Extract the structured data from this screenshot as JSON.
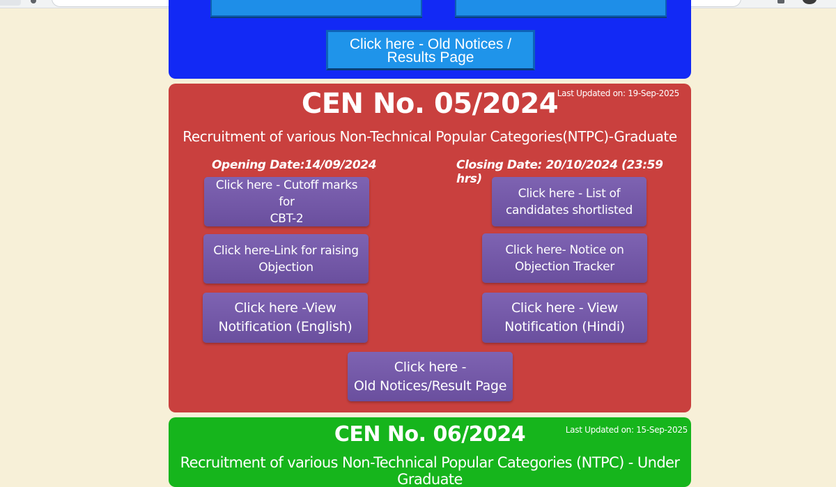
{
  "colors": {
    "page_background": "#f7f0d8",
    "blue_panel": "#1229f5",
    "blue_button": "#1f94ea",
    "red_panel": "#c9403e",
    "purple_button": "#7260a8",
    "green_panel": "#16b51c"
  },
  "browser": {
    "icons": [
      "back-icon",
      "extension-icon",
      "profile-avatar"
    ]
  },
  "top_section": {
    "old_notices_button": "Click here - Old Notices /\nResults Page"
  },
  "cen_05_2024": {
    "title": "CEN No. 05/2024",
    "last_updated": "Last Updated on: 19-Sep-2025",
    "subtitle": "Recruitment of various Non-Technical Popular Categories(NTPC)-Graduate",
    "opening_date": "Opening Date:14/09/2024",
    "closing_date": "Closing Date: 20/10/2024 (23:59 hrs)",
    "buttons": [
      "Click here - Cutoff marks for\nCBT-2",
      "Click here - List of\ncandidates shortlisted",
      "Click here-Link for raising\nObjection",
      "Click here- Notice on\nObjection Tracker",
      "Click here  -View\nNotification (English)",
      "Click here - View\nNotification (Hindi)",
      "Click here -\nOld Notices/Result Page"
    ]
  },
  "cen_06_2024": {
    "title": "CEN No. 06/2024",
    "last_updated": "Last Updated on: 15-Sep-2025",
    "subtitle": "Recruitment of various Non-Technical Popular Categories (NTPC) - Under Graduate"
  }
}
